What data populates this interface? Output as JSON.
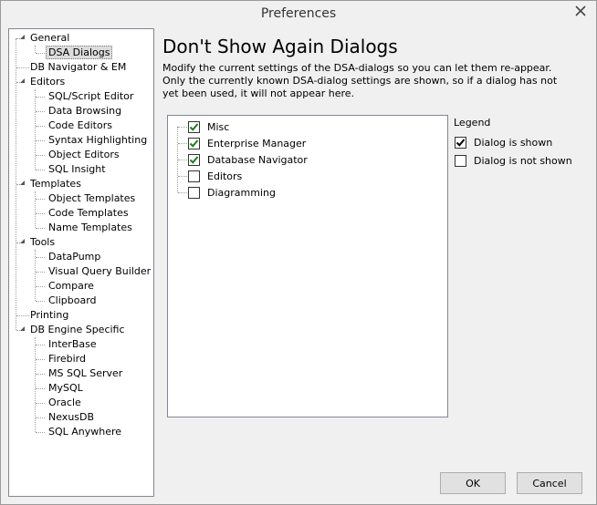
{
  "window": {
    "title": "Preferences"
  },
  "tree": [
    {
      "label": "General",
      "level": 0,
      "expanded": true,
      "selected": false
    },
    {
      "label": "DSA Dialogs",
      "level": 1,
      "selected": true
    },
    {
      "label": "DB Navigator & EM",
      "level": 0,
      "selected": false
    },
    {
      "label": "Editors",
      "level": 0,
      "expanded": true,
      "selected": false
    },
    {
      "label": "SQL/Script Editor",
      "level": 1,
      "selected": false
    },
    {
      "label": "Data Browsing",
      "level": 1,
      "selected": false
    },
    {
      "label": "Code Editors",
      "level": 1,
      "selected": false
    },
    {
      "label": "Syntax Highlighting",
      "level": 1,
      "selected": false
    },
    {
      "label": "Object Editors",
      "level": 1,
      "selected": false
    },
    {
      "label": "SQL Insight",
      "level": 1,
      "selected": false
    },
    {
      "label": "Templates",
      "level": 0,
      "expanded": true,
      "selected": false
    },
    {
      "label": "Object Templates",
      "level": 1,
      "selected": false
    },
    {
      "label": "Code Templates",
      "level": 1,
      "selected": false
    },
    {
      "label": "Name Templates",
      "level": 1,
      "selected": false
    },
    {
      "label": "Tools",
      "level": 0,
      "expanded": true,
      "selected": false
    },
    {
      "label": "DataPump",
      "level": 1,
      "selected": false
    },
    {
      "label": "Visual Query Builder",
      "level": 1,
      "selected": false
    },
    {
      "label": "Compare",
      "level": 1,
      "selected": false
    },
    {
      "label": "Clipboard",
      "level": 1,
      "selected": false
    },
    {
      "label": "Printing",
      "level": 0,
      "selected": false
    },
    {
      "label": "DB Engine Specific",
      "level": 0,
      "expanded": true,
      "selected": false
    },
    {
      "label": "InterBase",
      "level": 1,
      "selected": false
    },
    {
      "label": "Firebird",
      "level": 1,
      "selected": false
    },
    {
      "label": "MS SQL Server",
      "level": 1,
      "selected": false
    },
    {
      "label": "MySQL",
      "level": 1,
      "selected": false
    },
    {
      "label": "Oracle",
      "level": 1,
      "selected": false
    },
    {
      "label": "NexusDB",
      "level": 1,
      "selected": false
    },
    {
      "label": "SQL Anywhere",
      "level": 1,
      "selected": false
    }
  ],
  "main": {
    "title": "Don't Show Again Dialogs",
    "description": "Modify the current settings of the DSA-dialogs so you can let them re-appear. Only the currently known DSA-dialog settings are shown, so if a dialog has not yet been used, it will not appear here."
  },
  "dialogs": [
    {
      "label": "Misc",
      "checked": true
    },
    {
      "label": "Enterprise Manager",
      "checked": true
    },
    {
      "label": "Database Navigator",
      "checked": true
    },
    {
      "label": "Editors",
      "checked": false
    },
    {
      "label": "Diagramming",
      "checked": false
    }
  ],
  "legend": {
    "title": "Legend",
    "items": [
      {
        "label": "Dialog is shown",
        "checked": true
      },
      {
        "label": "Dialog is not shown",
        "checked": false
      }
    ]
  },
  "buttons": {
    "ok": "OK",
    "cancel": "Cancel"
  },
  "colors": {
    "check": "#1a7f1a"
  }
}
